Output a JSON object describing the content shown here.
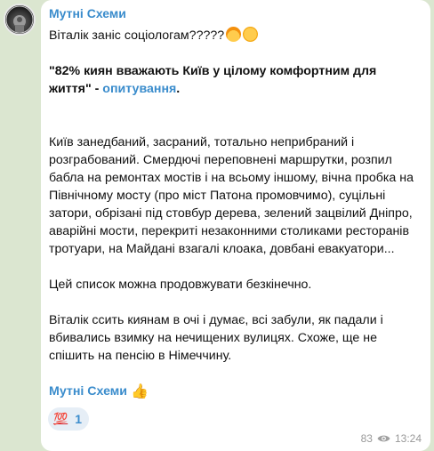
{
  "message": {
    "channel_name": "Мутні Схеми",
    "line1": "Віталік заніс соціологам?????",
    "quote": "\"82% киян вважають Київ у цілому комфортним для життя\"",
    "quote_dash": " - ",
    "poll_link": "опитування",
    "quote_end": ".",
    "paragraph2": "Київ занедбаний, засраний, тотально неприбраний і розграбований. Смердючі переповнені маршрутки, розпил бабла на ремонтах мостів і на всьому іншому, вічна пробка на Північному мосту (про міст Патона промовчимо), суцільні затори, обрізані під стовбур дерева, зелений зацвілий Дніпро, аварійні мости, перекриті незаконними столиками ресторанів тротуари, на Майдані взагалі клоака, довбані евакуатори...",
    "paragraph3": "Цей список можна продовжувати безкінечно.",
    "paragraph4": "Віталік ссить киянам в очі і думає, всі забули, як падали і вбивались взимку на нечищених вулицях. Схоже, ще не спішить на пенсію в Німеччину.",
    "signature_link": "Мутні Схеми"
  },
  "reaction": {
    "emoji": "💯",
    "count": "1"
  },
  "meta": {
    "views": "83",
    "time": "13:24"
  },
  "icons": [
    "avatar",
    "exploding-head-emoji",
    "grinning-emoji",
    "thumbs-up-emoji",
    "hundred-points-emoji",
    "eye-icon"
  ]
}
